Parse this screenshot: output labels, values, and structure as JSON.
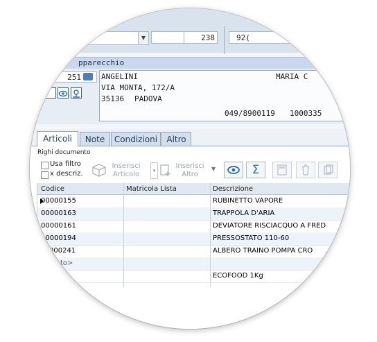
{
  "top": {
    "field_number": "238",
    "field_right": "92("
  },
  "panel": {
    "header": "pparecchio",
    "code": "251",
    "name": "ANGELINI",
    "name_right": "MARIA C",
    "street": "VIA MONTA, 172/A",
    "zip": "35136",
    "city": "PADOVA",
    "phone": "049/8900119",
    "number": "1000335"
  },
  "tabs": [
    "Articoli",
    "Note",
    "Condizioni",
    "Altro"
  ],
  "document": {
    "section_label": "Righi documento",
    "filters": [
      {
        "label": "Usa filtro",
        "checked": false
      },
      {
        "label": "x descriz.",
        "checked": false
      }
    ],
    "toolbar": {
      "insert_article": "Inserisci\nArticolo",
      "insert_other": "Inserisci\nAltro",
      "view_icon": "eye-icon",
      "sum_icon": "sigma-icon",
      "calc_icon": "calculator-icon",
      "delete_icon": "trash-icon",
      "copy_icon": "copy-icon"
    }
  },
  "grid": {
    "columns": [
      "Codice",
      "Matricola Lista",
      "Descrizione"
    ],
    "rows": [
      {
        "code": "00000155",
        "matricola": "",
        "desc": "RUBINETTO VAPORE",
        "selected": true
      },
      {
        "code": "00000163",
        "matricola": "",
        "desc": "TRAPPOLA D'ARIA",
        "selected": false
      },
      {
        "code": "00000161",
        "matricola": "",
        "desc": "DEVIATORE RISCIACQUO A FRED",
        "selected": false
      },
      {
        "code": "00000194",
        "matricola": "",
        "desc": "PRESSOSTATO 110-60",
        "selected": false
      },
      {
        "code": "000241",
        "matricola": "",
        "desc": "ALBERO TRAINO POMPA CRO",
        "selected": false
      },
      {
        "code": "to>",
        "matricola": "",
        "desc": "",
        "selected": false
      },
      {
        "code": "",
        "matricola": "",
        "desc": "ECOFOOD 1Kg",
        "selected": false
      }
    ]
  },
  "colors": {
    "accent": "#2f6fb0",
    "header_bg": "#c9d8ea",
    "alt_row": "#eef3fa"
  }
}
